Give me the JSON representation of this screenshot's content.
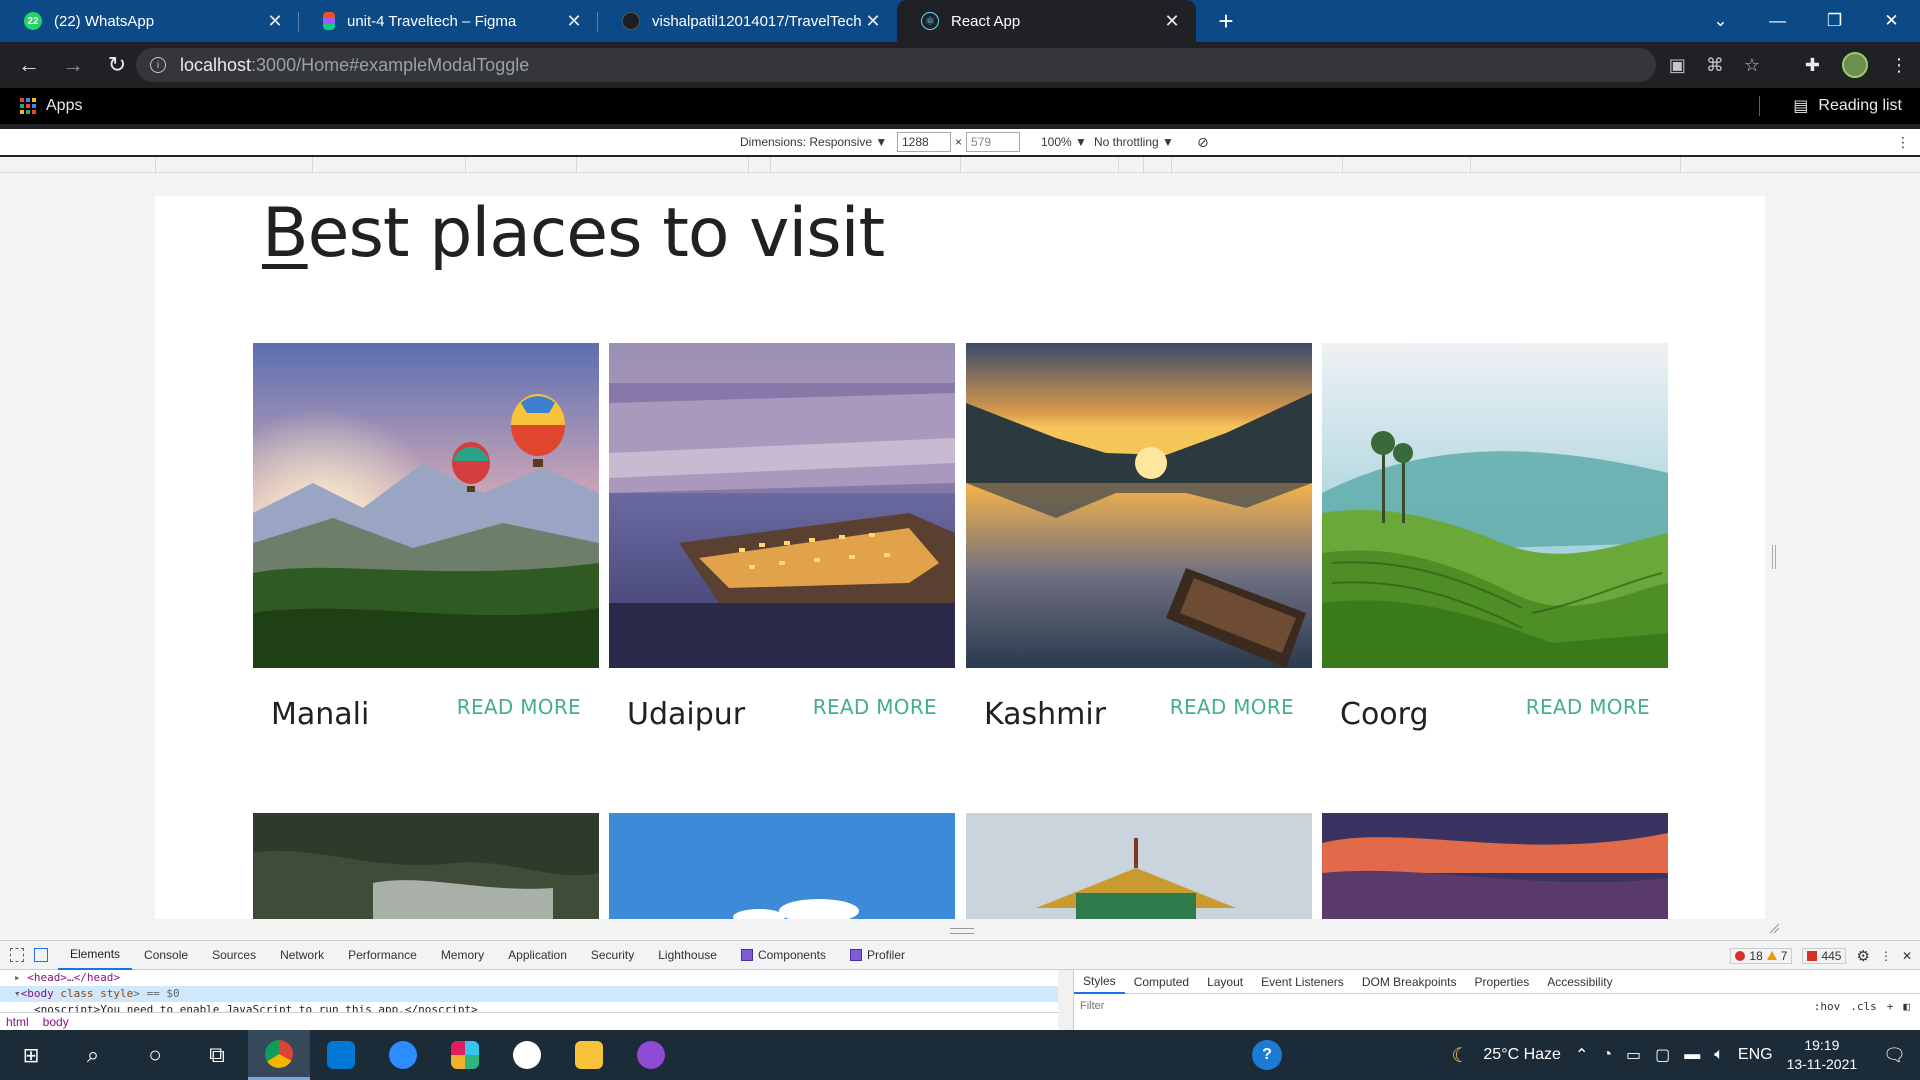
{
  "browser": {
    "tabs": [
      {
        "title": "(22) WhatsApp",
        "icon": "whatsapp-icon",
        "color": "#25d366"
      },
      {
        "title": "unit-4 Traveltech – Figma",
        "icon": "figma-icon",
        "color": "#f24e1e"
      },
      {
        "title": "vishalpatil12014017/TravelTech",
        "icon": "github-icon",
        "color": "#24292e"
      },
      {
        "title": "React App",
        "icon": "react-icon",
        "color": "#61dafb"
      }
    ],
    "address": {
      "host": "localhost",
      "path": ":3000/Home#exampleModalToggle"
    },
    "bookmarks": {
      "apps_label": "Apps",
      "reading_list_label": "Reading list"
    }
  },
  "device_toolbar": {
    "dimensions_label": "Dimensions: Responsive ▼",
    "width": "1288",
    "times": "×",
    "height": "579",
    "zoom": "100% ▼",
    "throttling": "No throttling ▼"
  },
  "page": {
    "heading_first_letter": "B",
    "heading_rest": "est places to visit",
    "read_more_label": "READ MORE",
    "places": [
      {
        "name": "Manali"
      },
      {
        "name": "Udaipur"
      },
      {
        "name": "Kashmir"
      },
      {
        "name": "Coorg"
      }
    ],
    "accent_color": "#43b08d"
  },
  "devtools": {
    "tabs": [
      "Elements",
      "Console",
      "Sources",
      "Network",
      "Performance",
      "Memory",
      "Application",
      "Security",
      "Lighthouse",
      "Components",
      "Profiler"
    ],
    "errors": "18",
    "warnings": "7",
    "issues": "445",
    "dom": {
      "line1_tag": "<head>…</head>",
      "line2_open": "<body",
      "line2_attr": "class style",
      "line2_rest": "> == $0",
      "line3": "<noscript>You need to enable JavaScript to run this app.</noscript>"
    },
    "crumbs": [
      "html",
      "body"
    ],
    "styles_tabs": [
      "Styles",
      "Computed",
      "Layout",
      "Event Listeners",
      "DOM Breakpoints",
      "Properties",
      "Accessibility"
    ],
    "filter_placeholder": "Filter",
    "filter_opts": [
      ":hov",
      ".cls",
      "+"
    ]
  },
  "taskbar": {
    "weather": "25°C  Haze",
    "language": "ENG",
    "time": "19:19",
    "date": "13-11-2021"
  }
}
